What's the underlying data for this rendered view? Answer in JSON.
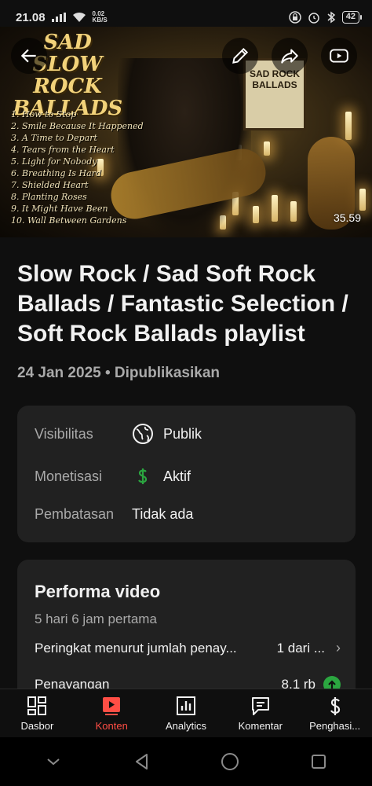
{
  "status_bar": {
    "time": "21.08",
    "net_speed_value": "0.02",
    "net_speed_unit": "KB/S",
    "battery": "42"
  },
  "thumbnail": {
    "title_line1": "SAD",
    "title_line2": "SLOW ROCK",
    "title_line3": "BALLADS",
    "poster_text": "SAD ROCK BALLADS",
    "tracks": [
      "1. How to Stop",
      "2. Smile Because It Happened",
      "3. A Time to Depart",
      "4. Tears from the Heart",
      "5. Light for Nobody",
      "6. Breathing Is Hard",
      "7. Shielded Heart",
      "8. Planting Roses",
      "9. It Might Have Been",
      "10. Wall Between Gardens"
    ],
    "duration": "35.59"
  },
  "video": {
    "title": "Slow Rock / Sad Soft Rock Ballads / Fantastic Selection / Soft Rock Ballads playlist",
    "date": "24 Jan 2025",
    "separator": "•",
    "status": "Dipublikasikan"
  },
  "details": {
    "visibility_label": "Visibilitas",
    "visibility_value": "Publik",
    "monetization_label": "Monetisasi",
    "monetization_value": "Aktif",
    "restriction_label": "Pembatasan",
    "restriction_value": "Tidak ada"
  },
  "performance": {
    "title": "Performa video",
    "period": "5 hari 6 jam pertama",
    "rank_label": "Peringkat menurut jumlah penay...",
    "rank_value": "1 dari ...",
    "views_label": "Penayangan",
    "views_value": "8,1 rb"
  },
  "bottom_nav": [
    {
      "label": "Dasbor",
      "icon": "dashboard-icon"
    },
    {
      "label": "Konten",
      "icon": "content-icon"
    },
    {
      "label": "Analytics",
      "icon": "analytics-icon"
    },
    {
      "label": "Komentar",
      "icon": "comment-icon"
    },
    {
      "label": "Penghasi...",
      "icon": "dollar-icon"
    }
  ],
  "colors": {
    "background": "#0f0f0f",
    "card": "#212121",
    "accent_active": "#ff4e45",
    "money_green": "#2ba640",
    "secondary_text": "#aaaaaa"
  }
}
